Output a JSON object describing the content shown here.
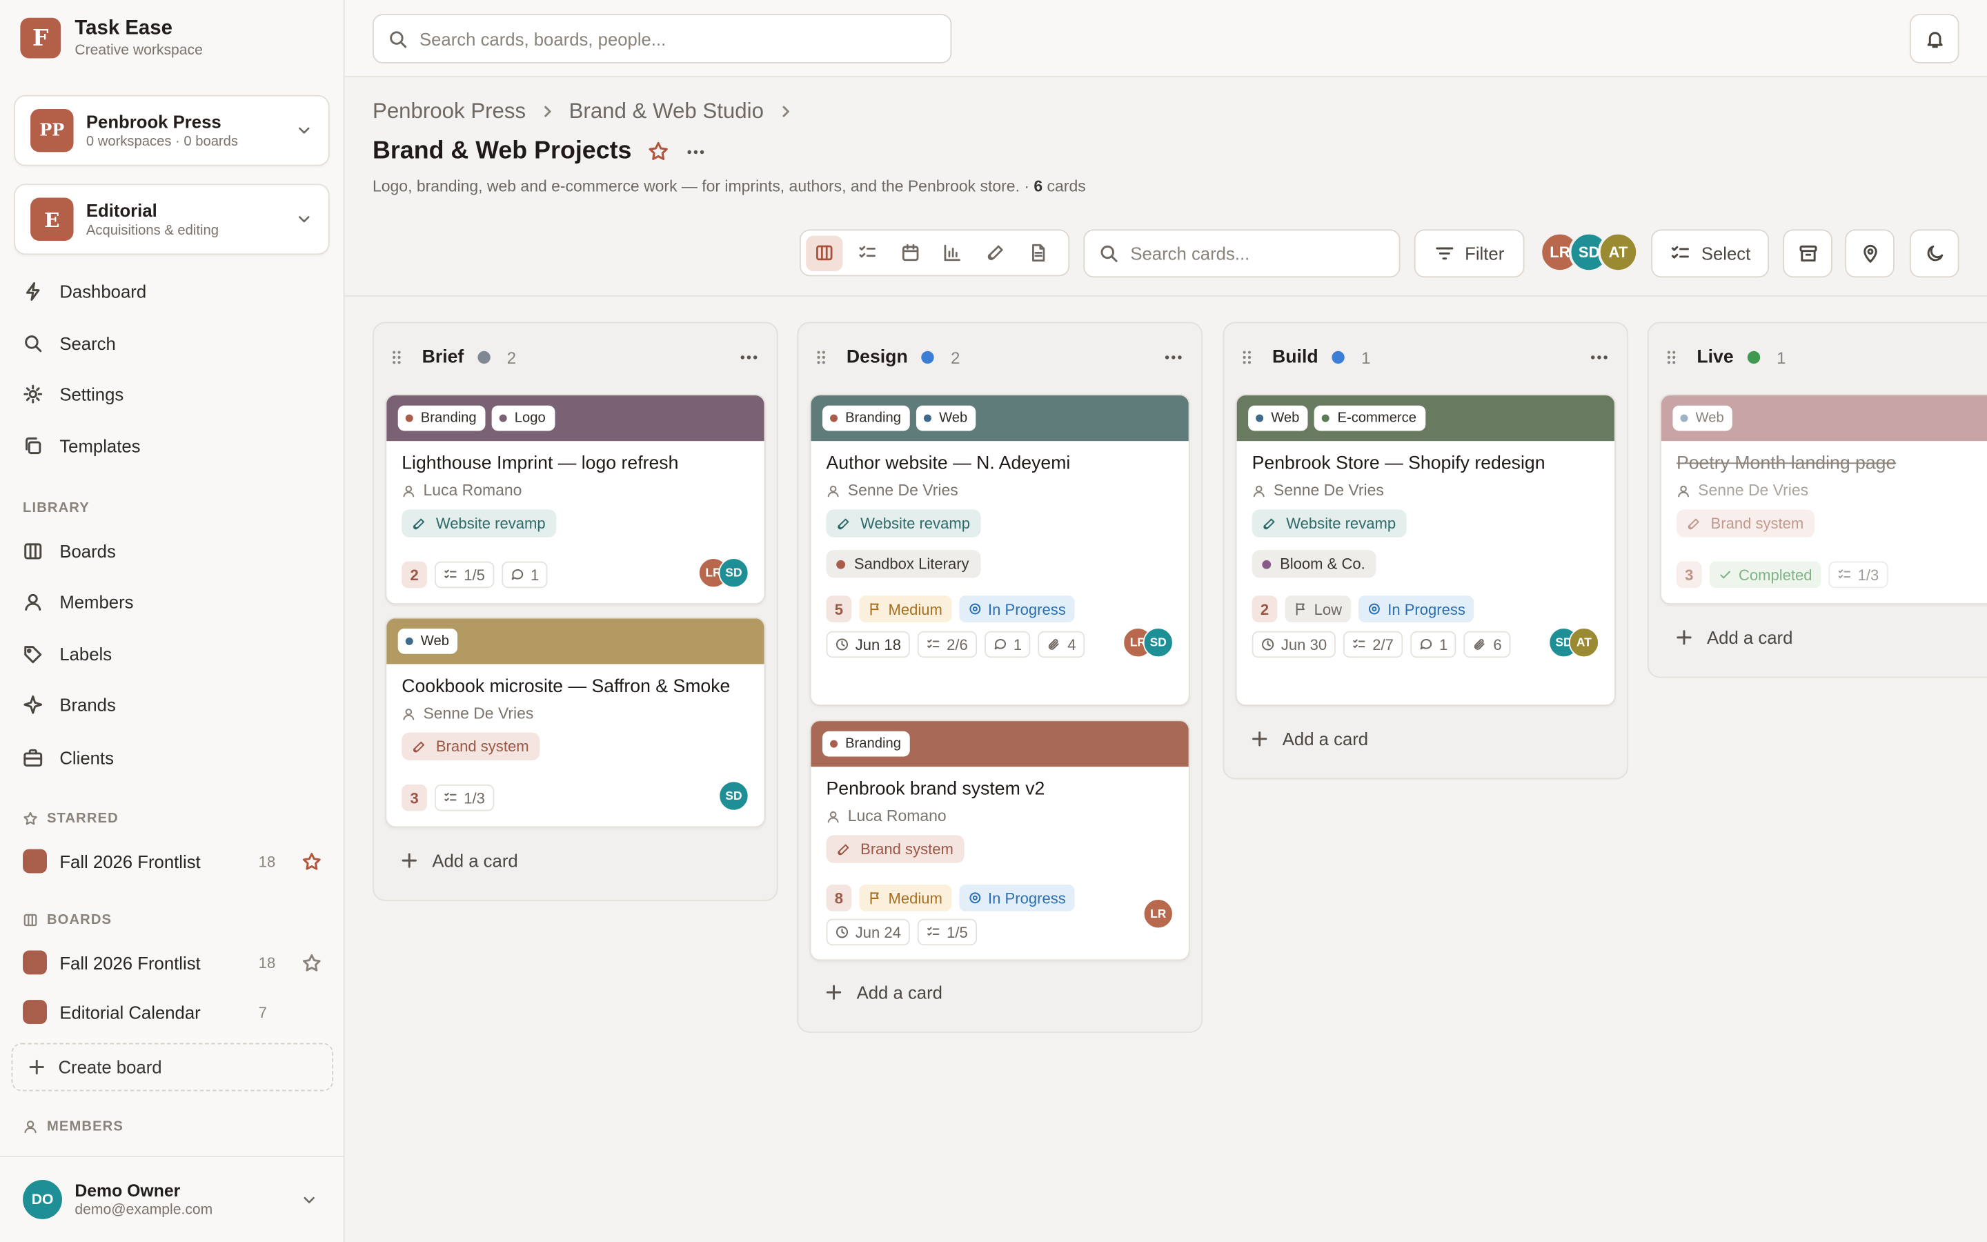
{
  "app": {
    "name": "Task Ease",
    "subtitle": "Creative workspace",
    "logo_letter": "F"
  },
  "org": {
    "badge": "PP",
    "name": "Penbrook Press",
    "meta": "0 workspaces · 0 boards",
    "color": "#b45f47"
  },
  "workspace": {
    "badge": "E",
    "name": "Editorial",
    "meta": "Acquisitions & editing",
    "color": "#b45f47"
  },
  "nav": [
    {
      "label": "Dashboard",
      "icon": "bolt-icon"
    },
    {
      "label": "Search",
      "icon": "search-icon"
    },
    {
      "label": "Settings",
      "icon": "gear-icon"
    },
    {
      "label": "Templates",
      "icon": "copy-icon"
    }
  ],
  "library": {
    "heading": "LIBRARY",
    "items": [
      {
        "label": "Boards",
        "icon": "columns-icon"
      },
      {
        "label": "Members",
        "icon": "user-icon"
      },
      {
        "label": "Labels",
        "icon": "tag-icon"
      },
      {
        "label": "Brands",
        "icon": "sparkle-icon"
      },
      {
        "label": "Clients",
        "icon": "briefcase-icon"
      }
    ]
  },
  "starred": {
    "heading": "STARRED",
    "items": [
      {
        "name": "Fall 2026 Frontlist",
        "count": "18",
        "starred": true
      }
    ]
  },
  "boards": {
    "heading": "BOARDS",
    "items": [
      {
        "name": "Fall 2026 Frontlist",
        "count": "18",
        "starred": false
      },
      {
        "name": "Editorial Calendar",
        "count": "7"
      }
    ],
    "create_label": "Create board"
  },
  "members_heading": "MEMBERS",
  "user": {
    "initials": "DO",
    "name": "Demo Owner",
    "email": "demo@example.com",
    "color": "#1f8f96"
  },
  "topbar": {
    "search_placeholder": "Search cards, boards, people..."
  },
  "breadcrumb": [
    "Penbrook Press",
    "Brand & Web Studio"
  ],
  "page": {
    "title": "Brand & Web Projects",
    "description": "Logo, branding, web and e-commerce work — for imprints, authors, and the Penbrook store. ·",
    "card_count": "6",
    "card_count_suffix": "cards"
  },
  "toolbar": {
    "views": [
      "board-view-icon",
      "checklist-view-icon",
      "calendar-view-icon",
      "chart-view-icon",
      "link-view-icon",
      "document-view-icon"
    ],
    "search_placeholder": "Search cards...",
    "filter_label": "Filter",
    "members": [
      {
        "initials": "LR",
        "color": "#b8694d"
      },
      {
        "initials": "SD",
        "color": "#1f8f96"
      },
      {
        "initials": "AT",
        "color": "#9a8a32"
      }
    ],
    "select_label": "Select"
  },
  "colors": {
    "accent": "#b1553f",
    "brief_dot": "#7f8792",
    "design_dot": "#3a7fd5",
    "build_dot": "#3a7fd5",
    "live_dot": "#3f9a4f"
  },
  "columns": [
    {
      "name": "Brief",
      "count": "2",
      "add_label": "Add a card",
      "cards": [
        {
          "labels": [
            "Branding",
            "Logo"
          ],
          "title": "Lighthouse Imprint — logo refresh",
          "assignee": "Luca Romano",
          "project": "Website revamp",
          "number": "2",
          "checklist": "1/5",
          "comments": "1",
          "avatars": [
            "LR",
            "SD"
          ]
        },
        {
          "labels": [
            "Web"
          ],
          "title": "Cookbook microsite — Saffron & Smoke",
          "assignee": "Senne De Vries",
          "project": "Brand system",
          "number": "3",
          "checklist": "1/3",
          "avatars": [
            "SD"
          ]
        }
      ]
    },
    {
      "name": "Design",
      "count": "2",
      "add_label": "Add a card",
      "cards": [
        {
          "labels": [
            "Branding",
            "Web"
          ],
          "title": "Author website — N. Adeyemi",
          "assignee": "Senne De Vries",
          "project": "Website revamp",
          "client": "Sandbox Literary",
          "number": "5",
          "priority": "Medium",
          "status": "In Progress",
          "due": "Jun 18",
          "checklist": "2/6",
          "comments": "1",
          "attachments": "4",
          "avatars": [
            "LR",
            "SD"
          ]
        },
        {
          "labels": [
            "Branding"
          ],
          "title": "Penbrook brand system v2",
          "assignee": "Luca Romano",
          "project": "Brand system",
          "number": "8",
          "priority": "Medium",
          "status": "In Progress",
          "due": "Jun 24",
          "checklist": "1/5",
          "avatars": [
            "LR"
          ]
        }
      ]
    },
    {
      "name": "Build",
      "count": "1",
      "add_label": "Add a card",
      "cards": [
        {
          "labels": [
            "Web",
            "E-commerce"
          ],
          "title": "Penbrook Store — Shopify redesign",
          "assignee": "Senne De Vries",
          "project": "Website revamp",
          "client": "Bloom & Co.",
          "number": "2",
          "priority": "Low",
          "status": "In Progress",
          "due": "Jun 30",
          "checklist": "2/7",
          "comments": "1",
          "attachments": "6",
          "avatars": [
            "SD",
            "AT"
          ]
        }
      ]
    },
    {
      "name": "Live",
      "count": "1",
      "add_label": "Add a card",
      "cards": [
        {
          "labels": [
            "Web"
          ],
          "title": "Poetry Month landing page",
          "assignee": "Senne De Vries",
          "project": "Brand system",
          "number": "3",
          "status": "Completed",
          "checklist": "1/3"
        }
      ]
    }
  ]
}
